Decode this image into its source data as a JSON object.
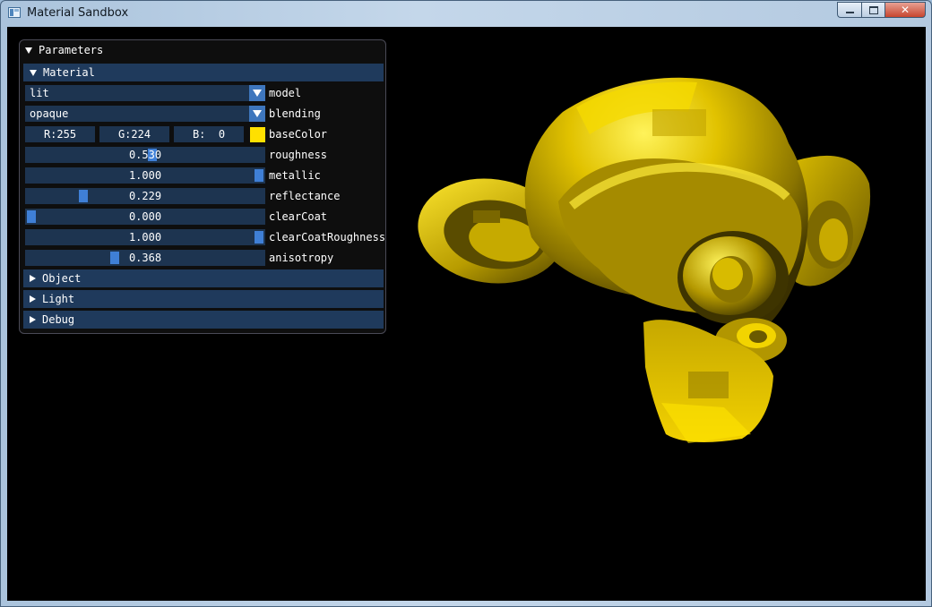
{
  "window": {
    "title": "Material Sandbox",
    "controls": {
      "minimize": "",
      "maximize": "",
      "close": "✕"
    }
  },
  "panel": {
    "title": "Parameters",
    "sections": {
      "material": "Material",
      "object": "Object",
      "light": "Light",
      "debug": "Debug"
    },
    "model": {
      "value": "lit",
      "label": "model"
    },
    "blending": {
      "value": "opaque",
      "label": "blending"
    },
    "baseColor": {
      "r_text": "R:255",
      "g_text": "G:224",
      "b_text": "B:  0",
      "label": "baseColor",
      "swatch_color": "#ffe000"
    },
    "sliders": [
      {
        "key": "roughness",
        "text": "0.530",
        "value": 0.53,
        "label": "roughness"
      },
      {
        "key": "metallic",
        "text": "1.000",
        "value": 1.0,
        "label": "metallic"
      },
      {
        "key": "reflectance",
        "text": "0.229",
        "value": 0.229,
        "label": "reflectance"
      },
      {
        "key": "clearCoat",
        "text": "0.000",
        "value": 0.0,
        "label": "clearCoat"
      },
      {
        "key": "clearCoatRoughness",
        "text": "1.000",
        "value": 1.0,
        "label": "clearCoatRoughness"
      },
      {
        "key": "anisotropy",
        "text": "0.368",
        "value": 0.368,
        "label": "anisotropy"
      }
    ]
  },
  "scene": {
    "object": "monkey-head-model",
    "material_color": "#ffe000",
    "background": "#000000"
  }
}
